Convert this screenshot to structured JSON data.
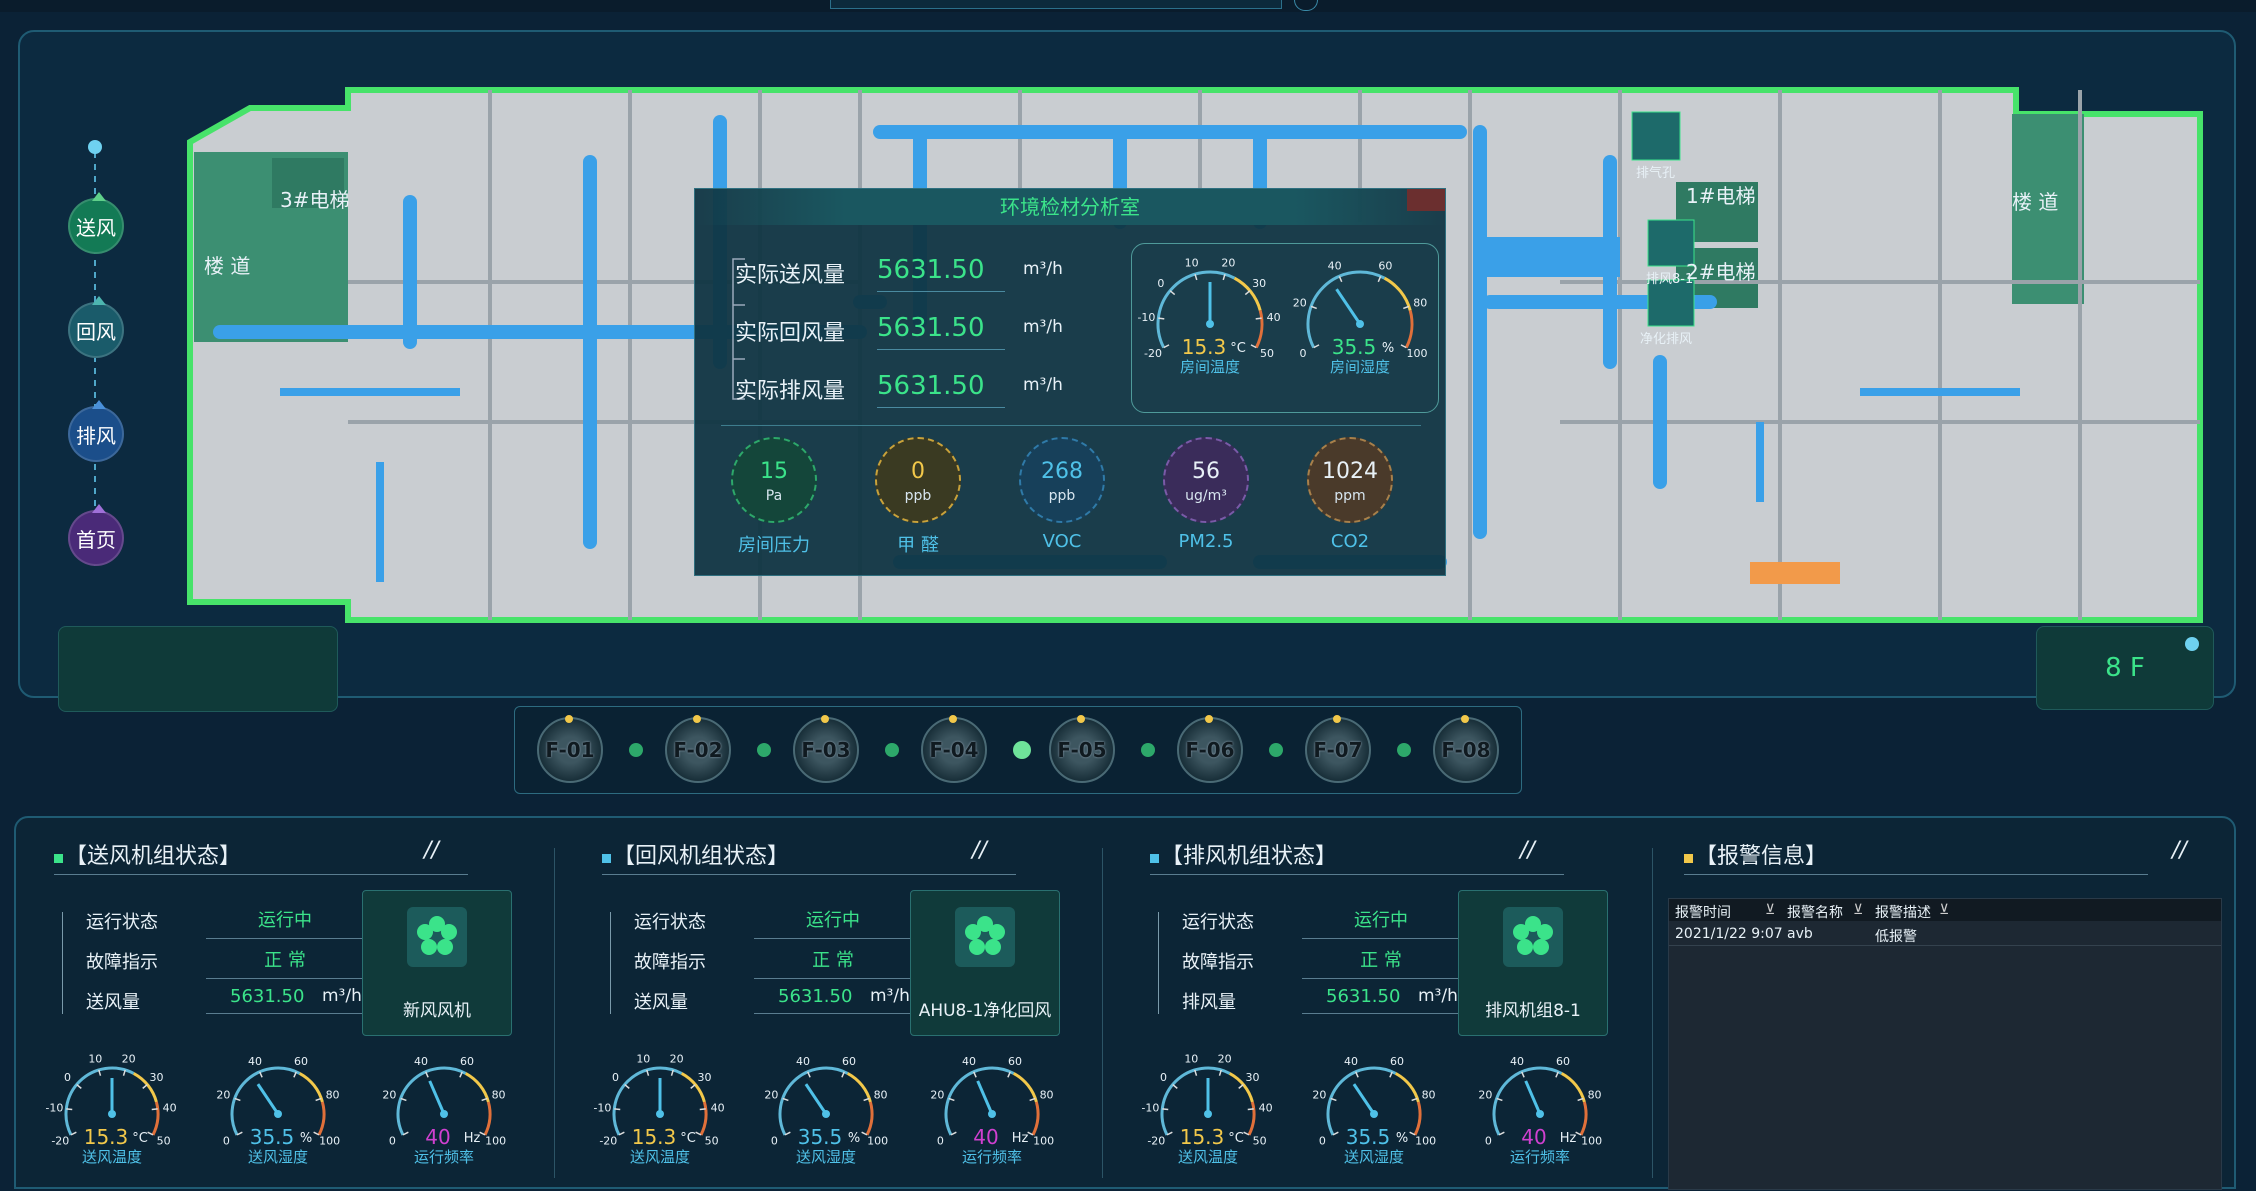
{
  "nav": {
    "items": [
      {
        "label": "送风",
        "color": "#137a55",
        "cap": "#5fd08a"
      },
      {
        "label": "回风",
        "color": "#1a5b6a",
        "cap": "#4db6b0"
      },
      {
        "label": "排风",
        "color": "#1b4e8a",
        "cap": "#4a90d9"
      },
      {
        "label": "首页",
        "color": "#4a2a78",
        "cap": "#a070d8"
      }
    ]
  },
  "map": {
    "labels": {
      "elevator3": "3#电梯",
      "stair_left": "楼 道",
      "elevator1": "1#电梯",
      "elevator2": "2#电梯",
      "stair_right": "楼 道",
      "fan_exhaust_hole": "排气孔",
      "fan_exhaust_81": "排风8-1",
      "fan_purify": "净化排风"
    },
    "floor_label": "8 F"
  },
  "popup": {
    "title": "环境检材分析室",
    "flows": [
      {
        "label": "实际送风量",
        "value": "5631.50",
        "unit": "m³/h"
      },
      {
        "label": "实际回风量",
        "value": "5631.50",
        "unit": "m³/h"
      },
      {
        "label": "实际排风量",
        "value": "5631.50",
        "unit": "m³/h"
      }
    ],
    "gauges": [
      {
        "value": "15.3",
        "unit": "°C",
        "label": "房间温度",
        "ticks": [
          "-20",
          "-10",
          "0",
          "10",
          "20",
          "30",
          "40",
          "50"
        ],
        "fraction": 0.5,
        "color": "#f2c84a"
      },
      {
        "value": "35.5",
        "unit": "%",
        "label": "房间湿度",
        "ticks": [
          "0",
          "20",
          "40",
          "60",
          "80",
          "100"
        ],
        "fraction": 0.355,
        "color": "#3be38a"
      }
    ],
    "sensors": [
      {
        "value": "15",
        "unit": "Pa",
        "label": "房间压力",
        "color": "#3be38a",
        "border": "#2da86a",
        "bg": "#14463a"
      },
      {
        "value": "0",
        "unit": "ppb",
        "label": "甲  醛",
        "color": "#f2c84a",
        "border": "#c9a23a",
        "bg": "#3a3a22"
      },
      {
        "value": "268",
        "unit": "ppb",
        "label": "VOC",
        "color": "#4fc1e8",
        "border": "#2f7aa8",
        "bg": "#17405a"
      },
      {
        "value": "56",
        "unit": "ug/m³",
        "label": "PM2.5",
        "color": "#e8f1f7",
        "border": "#7a5aa8",
        "bg": "#3a2c5a"
      },
      {
        "value": "1024",
        "unit": "ppm",
        "label": "CO2",
        "color": "#e8f1f7",
        "border": "#a8804a",
        "bg": "#4a3a2a"
      }
    ]
  },
  "floors": [
    "F-01",
    "F-02",
    "F-03",
    "F-04",
    "F-05",
    "F-06",
    "F-07",
    "F-08"
  ],
  "sections": [
    {
      "title": "【送风机组状态】",
      "sq": "#3be38a",
      "rows": [
        {
          "label": "运行状态",
          "value": "运行中"
        },
        {
          "label": "故障指示",
          "value": "正  常"
        },
        {
          "label": "送风量",
          "value": "5631.50",
          "unit": "m³/h"
        }
      ],
      "unit_name": "新风风机",
      "gauges": [
        {
          "value": "15.3",
          "unit": "°C",
          "label": "送风温度",
          "color": "#f2c84a",
          "ticks": [
            "-20",
            "-10",
            "0",
            "10",
            "20",
            "30",
            "40",
            "50"
          ],
          "fraction": 0.5
        },
        {
          "value": "35.5",
          "unit": "%",
          "label": "送风湿度",
          "color": "#4fc1e8",
          "ticks": [
            "0",
            "20",
            "40",
            "60",
            "80",
            "100"
          ],
          "fraction": 0.355
        },
        {
          "value": "40",
          "unit": "Hz",
          "label": "运行频率",
          "color": "#d040d0",
          "ticks": [
            "0",
            "20",
            "40",
            "60",
            "80",
            "100"
          ],
          "fraction": 0.4
        }
      ]
    },
    {
      "title": "【回风机组状态】",
      "sq": "#4fc1e8",
      "rows": [
        {
          "label": "运行状态",
          "value": "运行中"
        },
        {
          "label": "故障指示",
          "value": "正  常"
        },
        {
          "label": "送风量",
          "value": "5631.50",
          "unit": "m³/h"
        }
      ],
      "unit_name": "AHU8-1净化回风",
      "gauges": [
        {
          "value": "15.3",
          "unit": "°C",
          "label": "送风温度",
          "color": "#f2c84a",
          "ticks": [
            "-20",
            "-10",
            "0",
            "10",
            "20",
            "30",
            "40",
            "50"
          ],
          "fraction": 0.5
        },
        {
          "value": "35.5",
          "unit": "%",
          "label": "送风湿度",
          "color": "#4fc1e8",
          "ticks": [
            "0",
            "20",
            "40",
            "60",
            "80",
            "100"
          ],
          "fraction": 0.355
        },
        {
          "value": "40",
          "unit": "Hz",
          "label": "运行频率",
          "color": "#d040d0",
          "ticks": [
            "0",
            "20",
            "40",
            "60",
            "80",
            "100"
          ],
          "fraction": 0.4
        }
      ]
    },
    {
      "title": "【排风机组状态】",
      "sq": "#4fc1e8",
      "rows": [
        {
          "label": "运行状态",
          "value": "运行中"
        },
        {
          "label": "故障指示",
          "value": "正  常"
        },
        {
          "label": "排风量",
          "value": "5631.50",
          "unit": "m³/h"
        }
      ],
      "unit_name": "排风机组8-1",
      "gauges": [
        {
          "value": "15.3",
          "unit": "°C",
          "label": "送风温度",
          "color": "#f2c84a",
          "ticks": [
            "-20",
            "-10",
            "0",
            "10",
            "20",
            "30",
            "40",
            "50"
          ],
          "fraction": 0.5
        },
        {
          "value": "35.5",
          "unit": "%",
          "label": "送风湿度",
          "color": "#4fc1e8",
          "ticks": [
            "0",
            "20",
            "40",
            "60",
            "80",
            "100"
          ],
          "fraction": 0.355
        },
        {
          "value": "40",
          "unit": "Hz",
          "label": "运行频率",
          "color": "#d040d0",
          "ticks": [
            "0",
            "20",
            "40",
            "60",
            "80",
            "100"
          ],
          "fraction": 0.4
        }
      ]
    }
  ],
  "alarm": {
    "title": "【报警信息】",
    "sq": "#f2c84a",
    "columns": [
      "报警时间",
      "报警名称",
      "报警描述"
    ],
    "rows": [
      [
        "2021/1/22 9:07",
        "avb",
        "低报警"
      ]
    ]
  },
  "slash": "//"
}
